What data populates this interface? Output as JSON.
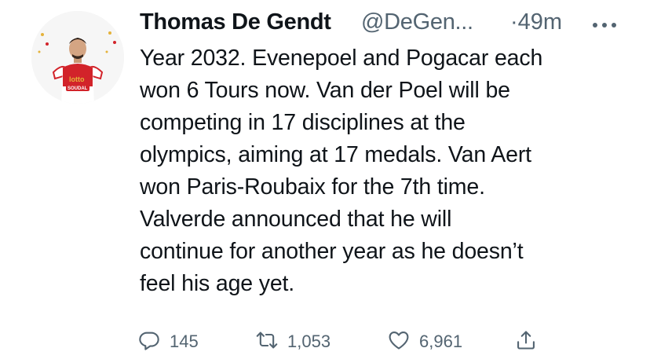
{
  "author": {
    "name": "Thomas De Gendt",
    "handle": "@DeGen...",
    "time": "·49m"
  },
  "tweet": {
    "lines": [
      "Year 2032. Evenepoel and Pogacar each",
      "won 6 Tours now. Van der Poel will be",
      "competing in 17 disciplines at the",
      "olympics, aiming at 17 medals. Van Aert",
      "won Paris-Roubaix for the 7th time.",
      "Valverde announced that he will",
      "continue for another year as he doesn’t",
      "feel his age yet."
    ]
  },
  "actions": {
    "reply_count": "145",
    "retweet_count": "1,053",
    "like_count": "6,961"
  },
  "icons": {
    "more": "more-dots-icon",
    "reply": "reply-icon",
    "retweet": "retweet-icon",
    "like": "heart-icon",
    "share": "share-icon"
  },
  "avatar_badge_texts": [
    "lotto",
    "SOUDAL"
  ],
  "colors": {
    "text": "#0f1419",
    "secondary": "#536471",
    "jersey_red": "#d2232a"
  }
}
